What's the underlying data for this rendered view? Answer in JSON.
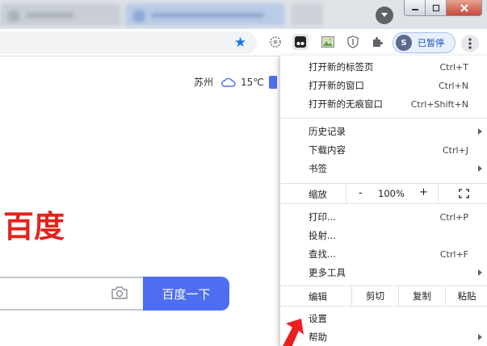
{
  "toolbar": {
    "paused_label": "已暂停",
    "avatar_letter": "S"
  },
  "weather": {
    "city": "苏州",
    "temperature": "15℃"
  },
  "page": {
    "logo_text": "百度",
    "search_button": "百度一下"
  },
  "menu": {
    "new_tab": {
      "label": "打开新的标签页",
      "shortcut": "Ctrl+T"
    },
    "new_window": {
      "label": "打开新的窗口",
      "shortcut": "Ctrl+N"
    },
    "new_incognito": {
      "label": "打开新的无痕窗口",
      "shortcut": "Ctrl+Shift+N"
    },
    "history": {
      "label": "历史记录"
    },
    "downloads": {
      "label": "下载内容",
      "shortcut": "Ctrl+J"
    },
    "bookmarks": {
      "label": "书签"
    },
    "zoom": {
      "label": "缩放",
      "minus": "-",
      "value": "100%",
      "plus": "+"
    },
    "print": {
      "label": "打印...",
      "shortcut": "Ctrl+P"
    },
    "cast": {
      "label": "投射..."
    },
    "find": {
      "label": "查找...",
      "shortcut": "Ctrl+F"
    },
    "more_tools": {
      "label": "更多工具"
    },
    "edit": {
      "label": "编辑",
      "cut": "剪切",
      "copy": "复制",
      "paste": "粘贴"
    },
    "settings": {
      "label": "设置"
    },
    "help": {
      "label": "帮助"
    }
  },
  "colors": {
    "accent_blue": "#4e6ef2",
    "logo_red": "#e2231a",
    "annotation_red": "#e8201f"
  }
}
